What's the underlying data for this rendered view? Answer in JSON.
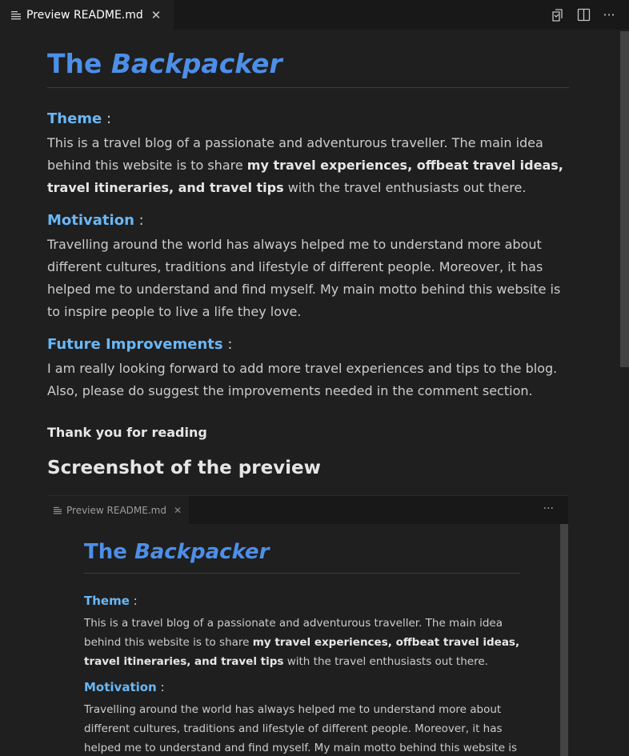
{
  "tab": {
    "label": "Preview README.md",
    "close": "✕"
  },
  "toolbar": {
    "open_source_icon": "open-source-icon",
    "split_icon": "split-editor-icon",
    "more": "···"
  },
  "doc": {
    "title_plain": "The ",
    "title_em": "Backpacker",
    "theme": {
      "heading": "Theme",
      "colon": " :",
      "text_1": "This is a travel blog of a passionate and adventurous traveller. The main idea behind this website is to share ",
      "bold": "my travel experiences, offbeat travel ideas, travel itineraries, and travel tips",
      "text_2": " with the travel enthusiasts out there."
    },
    "motivation": {
      "heading": "Motivation",
      "colon": " :",
      "text": "Travelling around the world has always helped me to understand more about different cultures, traditions and lifestyle of different people. Moreover, it has helped me to understand and find myself. My main motto behind this website is to inspire people to live a life they love."
    },
    "future": {
      "heading": "Future Improvements",
      "colon": " :",
      "text": "I am really looking forward to add more travel experiences and tips to the blog. Also, please do suggest the improvements needed in the comment section."
    },
    "thanks": "Thank you for reading",
    "screenshot_heading": "Screenshot of the preview"
  },
  "embed": {
    "tab_label": "Preview README.md",
    "close": "✕",
    "more": "···",
    "title_plain": "The ",
    "title_em": "Backpacker",
    "theme_heading": "Theme",
    "colon": " :",
    "theme_text_1": "This is a travel blog of a passionate and adventurous traveller. The main idea behind this website is to share ",
    "theme_bold": "my travel experiences, offbeat travel ideas, travel itineraries, and travel tips",
    "theme_text_2": " with the travel enthusiasts out there.",
    "motivation_heading": "Motivation",
    "motivation_text": "Travelling around the world has always helped me to understand more about different cultures, traditions and lifestyle of different people. Moreover, it has helped me to understand and find myself. My main motto behind this website is to inspire"
  },
  "colors": {
    "title_blue": "#4d8fe8",
    "heading_blue": "#6ab7f5",
    "background": "#1f1f1f"
  }
}
